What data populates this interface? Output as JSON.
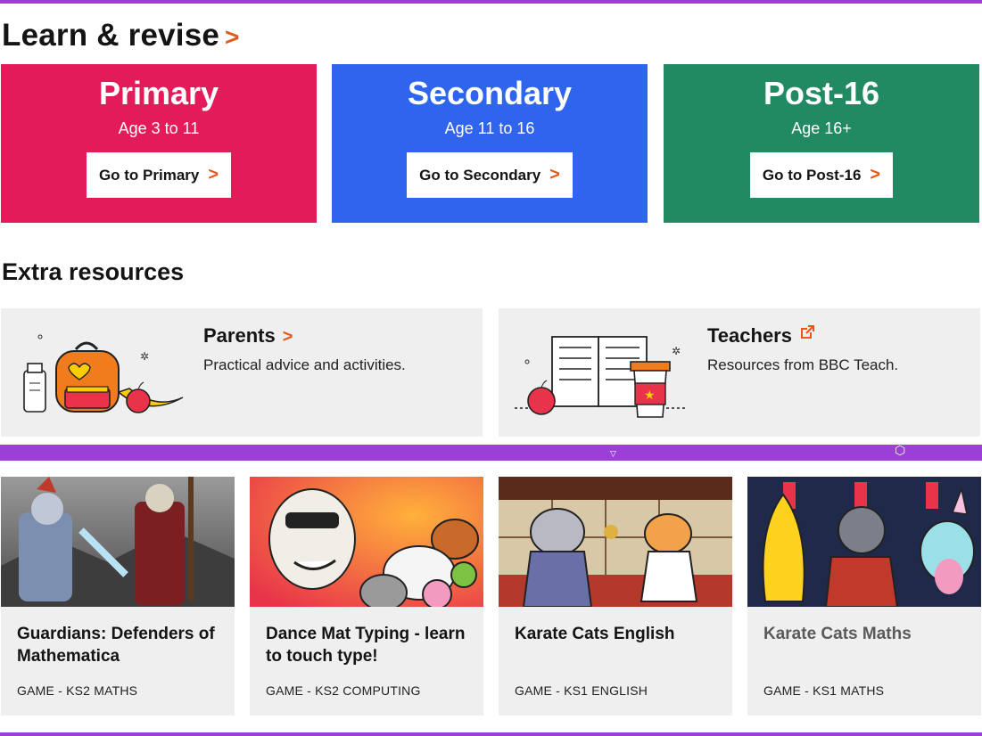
{
  "learn_revise": {
    "title": "Learn & revise",
    "chevron": ">",
    "phases": [
      {
        "name": "Primary",
        "age": "Age 3 to 11",
        "button": "Go to Primary",
        "color": "#e41b59"
      },
      {
        "name": "Secondary",
        "age": "Age 11 to 16",
        "button": "Go to Secondary",
        "color": "#2f65ec"
      },
      {
        "name": "Post-16",
        "age": "Age 16+",
        "button": "Go to Post-16",
        "color": "#218a63"
      }
    ]
  },
  "extra_resources": {
    "title": "Extra resources",
    "cards": [
      {
        "title": "Parents",
        "description": "Practical advice and activities.",
        "icon": "chevron-right-icon"
      },
      {
        "title": "Teachers",
        "description": "Resources from BBC Teach.",
        "icon": "external-link-icon"
      }
    ]
  },
  "games": [
    {
      "title": "Guardians: Defenders of Mathematica",
      "meta": "GAME - KS2 MATHS"
    },
    {
      "title": "Dance Mat Typing - learn to touch type!",
      "meta": "GAME - KS2 COMPUTING"
    },
    {
      "title": "Karate Cats English",
      "meta": "GAME - KS1 ENGLISH"
    },
    {
      "title": "Karate Cats Maths",
      "meta": "GAME - KS1 MATHS"
    }
  ],
  "colors": {
    "accent_orange": "#e2591b",
    "brand_purple": "#9b3fd6",
    "card_grey": "#efefef"
  }
}
